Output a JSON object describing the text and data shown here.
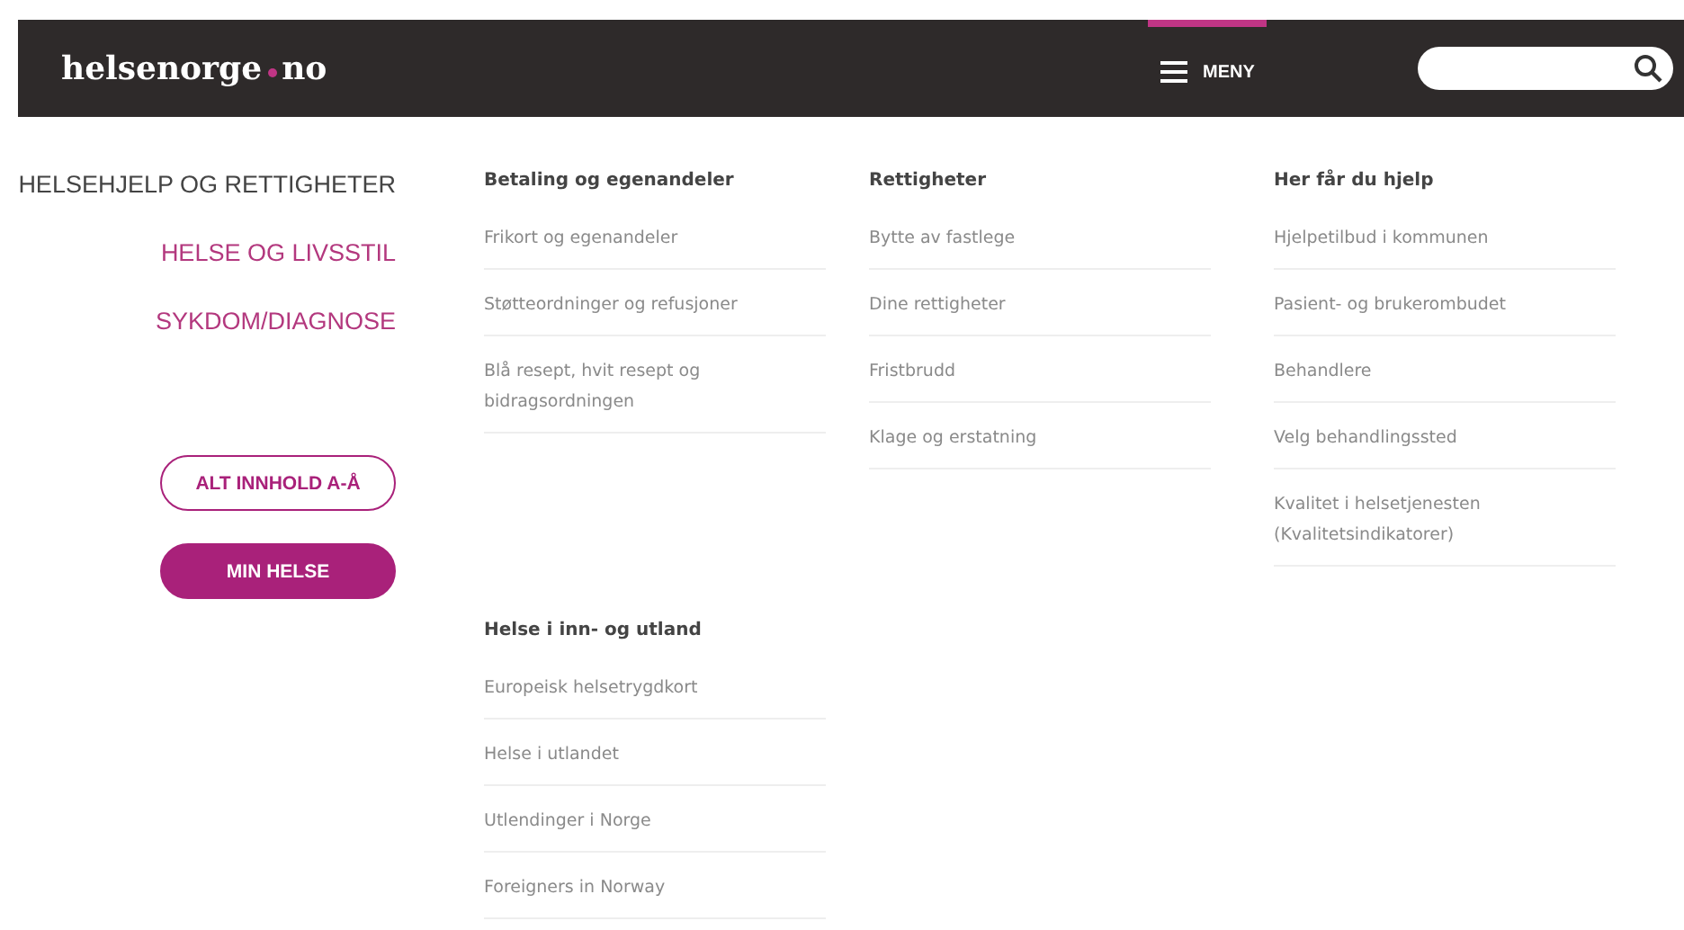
{
  "header": {
    "logo": {
      "first": "helsenorge",
      "second": "no"
    },
    "menu_button": {
      "label": "MENY",
      "selected": true
    }
  },
  "side_nav": {
    "items": [
      {
        "label": "HELSEHJELP OG RETTIGHETER",
        "selected": true
      },
      {
        "label": "HELSE OG LIVSSTIL",
        "selected": false
      },
      {
        "label": "SYKDOM/DIAGNOSE",
        "selected": false
      }
    ],
    "buttons": [
      {
        "label": "ALT INNHOLD A-Å",
        "kind": "outline"
      },
      {
        "label": "MIN HELSE",
        "kind": "filled"
      }
    ]
  },
  "sections": [
    {
      "heading": "Betaling og egenandeler",
      "links": [
        "Frikort og egenandeler",
        "Støtteordninger og refusjoner",
        "Blå resept, hvit resept og bidragsordningen"
      ]
    },
    {
      "heading": "Rettigheter",
      "links": [
        "Bytte av fastlege",
        "Dine rettigheter",
        "Fristbrudd",
        "Klage og erstatning"
      ]
    },
    {
      "heading": "Her får du hjelp",
      "links": [
        "Hjelpetilbud i kommunen",
        "Pasient- og brukerombudet",
        "Behandlere",
        "Velg behandlingssted",
        "Kvalitet i helsetjenesten (Kvalitetsindikatorer)"
      ]
    },
    {
      "heading": "Helse i inn- og utland",
      "links": [
        "Europeisk helsetrygdkort",
        "Helse i utlandet",
        "Utlendinger i Norge",
        "Foreigners in Norway"
      ]
    }
  ]
}
